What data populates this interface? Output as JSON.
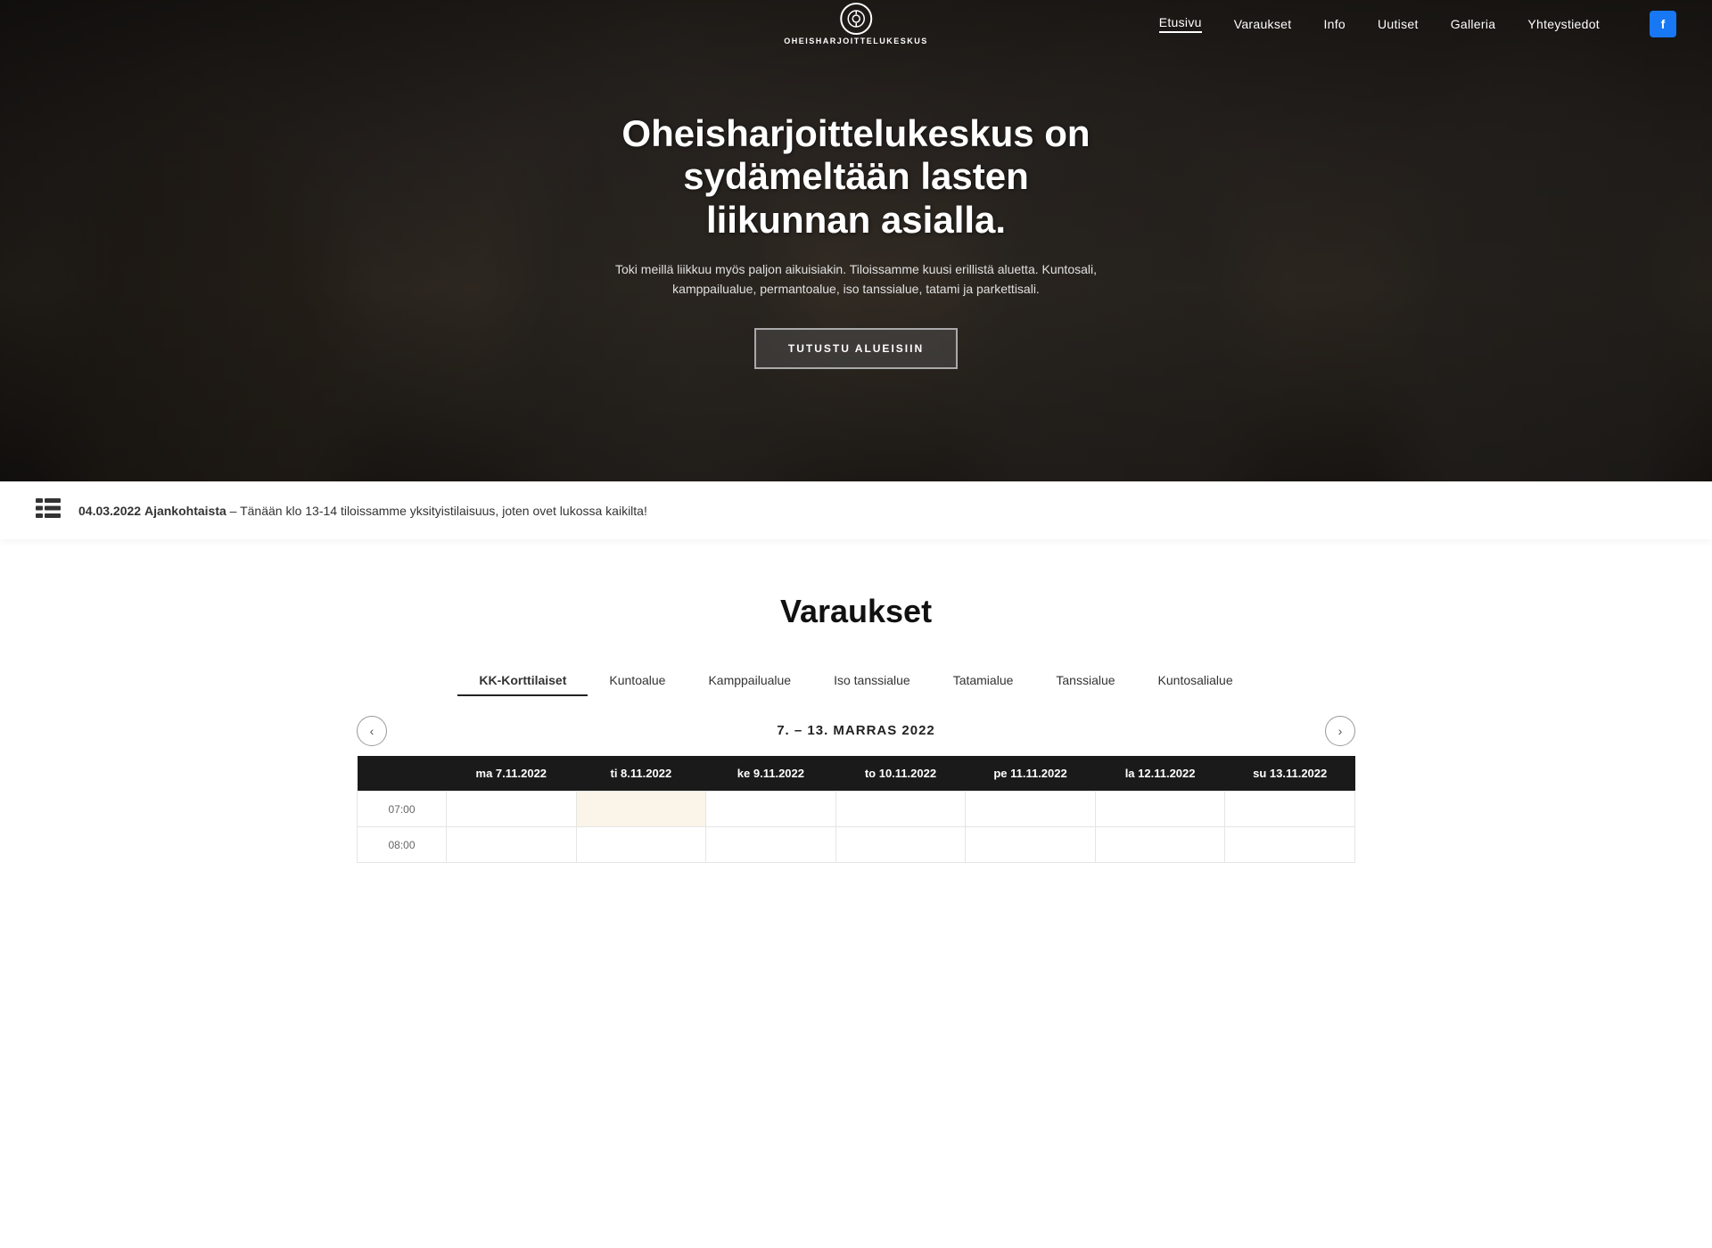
{
  "site": {
    "logo_text": "OHEISHARJOITTELUKESKUS",
    "facebook_label": "f"
  },
  "navbar": {
    "links": [
      {
        "id": "etusivu",
        "label": "Etusivu",
        "active": true
      },
      {
        "id": "varaukset",
        "label": "Varaukset",
        "active": false
      },
      {
        "id": "info",
        "label": "Info",
        "active": false
      },
      {
        "id": "uutiset",
        "label": "Uutiset",
        "active": false
      },
      {
        "id": "galleria",
        "label": "Galleria",
        "active": false
      },
      {
        "id": "yhteystiedot",
        "label": "Yhteystiedot",
        "active": false
      }
    ]
  },
  "hero": {
    "title": "Oheisharjoittelukeskus on sydämeltään lasten liikunnan asialla.",
    "subtitle": "Toki meillä liikkuu myös paljon aikuisiakin. Tiloissamme kuusi erillistä aluetta. Kuntosali, kamppailualue, permantoalue, iso tanssialue, tatami ja parkettisali.",
    "button_label": "TUTUSTU ALUEISIIN"
  },
  "news_ticker": {
    "date": "04.03.2022",
    "category": "Ajankohtaista",
    "text": "– Tänään klo 13-14 tiloissamme yksityistilaisuus, joten ovet lukossa kaikilta!"
  },
  "varaukset": {
    "title": "Varaukset",
    "tabs": [
      {
        "id": "kk-korttilaiset",
        "label": "KK-Korttilaiset",
        "active": true
      },
      {
        "id": "kuntoalue",
        "label": "Kuntoalue",
        "active": false
      },
      {
        "id": "kamppailualue",
        "label": "Kamppailualue",
        "active": false
      },
      {
        "id": "iso-tanssialue",
        "label": "Iso tanssialue",
        "active": false
      },
      {
        "id": "tatamialue",
        "label": "Tatamialue",
        "active": false
      },
      {
        "id": "tanssialue",
        "label": "Tanssialue",
        "active": false
      },
      {
        "id": "kuntosalialue",
        "label": "Kuntosalialue",
        "active": false
      }
    ],
    "calendar": {
      "week_label": "7. – 13. MARRAS 2022",
      "days": [
        {
          "label": "ma 7.11.2022"
        },
        {
          "label": "ti 8.11.2022"
        },
        {
          "label": "ke 9.11.2022"
        },
        {
          "label": "to 10.11.2022"
        },
        {
          "label": "pe 11.11.2022"
        },
        {
          "label": "la 12.11.2022"
        },
        {
          "label": "su 13.11.2022"
        }
      ],
      "time_slots": [
        {
          "time": "07:00",
          "cells": [
            "empty",
            "highlighted",
            "empty",
            "empty",
            "empty",
            "empty",
            "empty"
          ]
        },
        {
          "time": "08:00",
          "cells": [
            "empty",
            "empty",
            "empty",
            "empty",
            "empty",
            "empty",
            "empty"
          ]
        }
      ]
    }
  }
}
